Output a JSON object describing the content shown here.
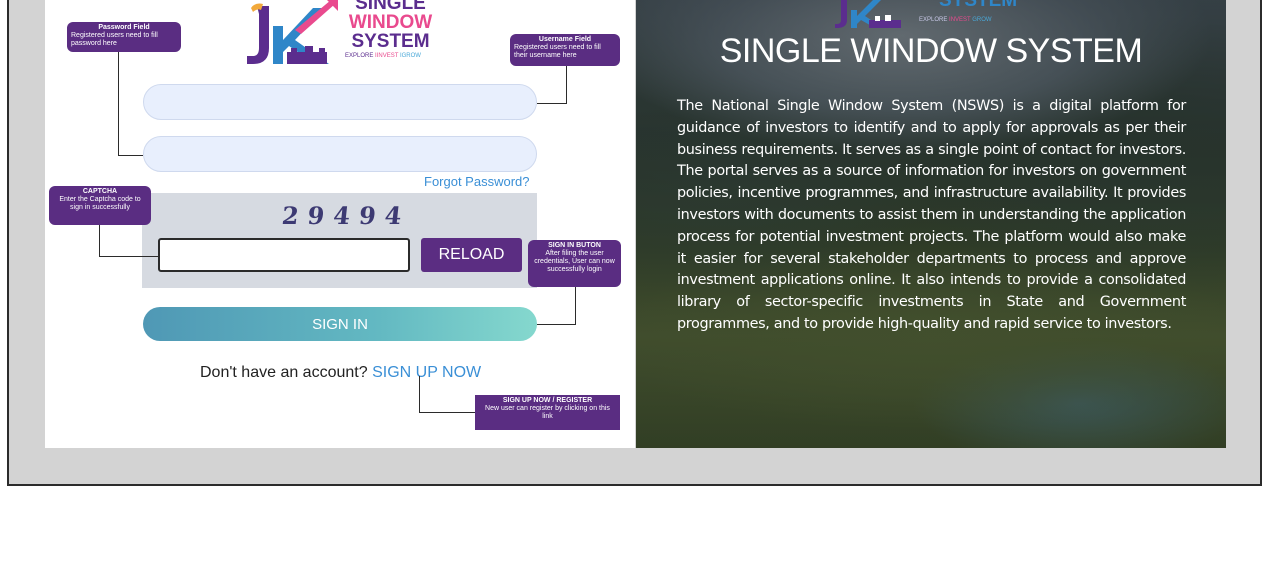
{
  "logo": {
    "line1": "SINGLE",
    "line2": "WINDOW",
    "line3": "SYSTEM",
    "tag_explore": "EXPLORE",
    "tag_invest": "INVEST",
    "tag_grow": "GROW",
    "sep": "I"
  },
  "right_logo": {
    "word": "SYSTEM",
    "tag_explore": "EXPLORE",
    "tag_invest": "INVEST",
    "tag_grow": "GROW"
  },
  "callouts": {
    "password": {
      "title": "Password Field",
      "desc": "Registered users need to fill password here"
    },
    "username": {
      "title": "Username Field",
      "desc": "Registered users need to fill their username here"
    },
    "captcha": {
      "title": "CAPTCHA",
      "desc": "Enter the Captcha code to sign in successfully"
    },
    "signin": {
      "title": "SIGN IN BUTON",
      "desc": "After filing the user credentials, User can now successfully login"
    },
    "signup": {
      "title": "SIGN UP NOW / REGISTER",
      "desc": "New user can register by clicking on this link"
    }
  },
  "form": {
    "forgot_password": "Forgot Password?",
    "captcha_code": "29494",
    "reload_label": "RELOAD",
    "signin_label": "SIGN IN",
    "no_account_text": "Don't have an account?",
    "signup_link": "SIGN UP NOW"
  },
  "info": {
    "title": "SINGLE WINDOW SYSTEM",
    "description": "The National Single Window System (NSWS) is a digital platform for guidance of investors to identify and to apply for approvals as per their business requirements. It serves as a single point of contact for investors. The portal serves as a source of information for investors on government policies, incentive programmes, and infrastructure availability. It provides investors with documents to assist them in understanding the application process for potential investment projects. The platform would also make it easier for several stakeholder departments to process and approve investment applications online. It also intends to provide a consolidated library of sector-specific investments in State and Government programmes, and to provide high-quality and rapid service to investors."
  },
  "colors": {
    "brand_purple": "#5b2d82",
    "brand_pink": "#e94a8e",
    "link_blue": "#3a8fd6",
    "frame_gray": "#d3d3d3"
  }
}
